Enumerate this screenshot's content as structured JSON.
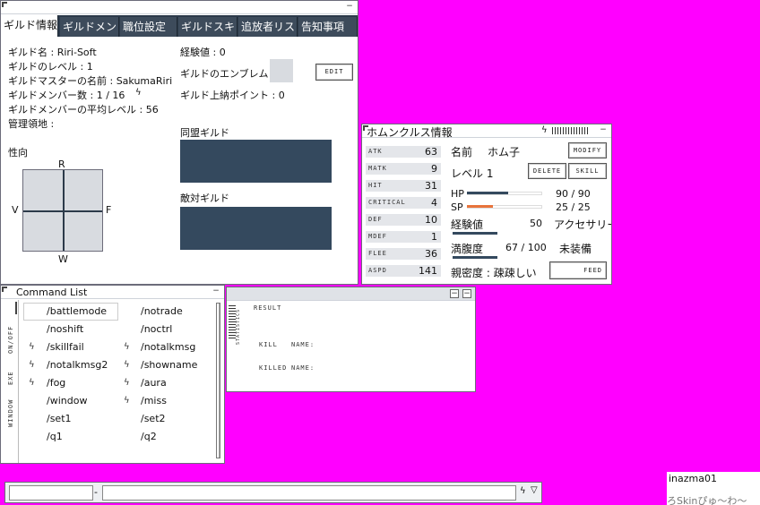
{
  "guild": {
    "tabs": [
      "ギルド情報",
      "ギルドメン・",
      "職位設定",
      "ギルドスキ・",
      "追放者リス・",
      "告知事項"
    ],
    "name_line": "ギルド名 : Riri-Soft",
    "level_line": "ギルドのレベル : 1",
    "master_line": "ギルドマスターの名前 : SakumaRiri",
    "members_line": "ギルドメンバー数 : 1 / 16",
    "avg_level_line": "ギルドメンバーの平均レベル : 56",
    "territory_line": "管理領地 :",
    "exp_line": "経験値 : 0",
    "emblem_label": "ギルドのエンブレム",
    "edit_button": "EDIT",
    "tax_points_line": "ギルド上納ポイント : 0",
    "alignment_label": "性向",
    "alignment_axes": {
      "top": "R",
      "left": "V",
      "right": "F",
      "bottom": "W"
    },
    "allied_label": "同盟ギルド",
    "hostile_label": "敵対ギルド"
  },
  "homunculus": {
    "title": "ホムンクルス情報",
    "stats": [
      {
        "label": "ATK",
        "value": "63"
      },
      {
        "label": "MATK",
        "value": "9"
      },
      {
        "label": "HIT",
        "value": "31"
      },
      {
        "label": "CRITICAL",
        "value": "4"
      },
      {
        "label": "DEF",
        "value": "10"
      },
      {
        "label": "MDEF",
        "value": "1"
      },
      {
        "label": "FLEE",
        "value": "36"
      },
      {
        "label": "ASPD",
        "value": "141"
      }
    ],
    "name_label": "名前",
    "name_value": "ホム子",
    "modify_button": "MODIFY",
    "level_line": "レベル 1",
    "delete_button": "DELETE",
    "skill_button": "SKILL",
    "hp_label": "HP",
    "hp_value": "90 / 90",
    "hp_fraction": 0.55,
    "sp_label": "SP",
    "sp_value": "25 / 25",
    "sp_fraction": 0.35,
    "exp_label": "経験値",
    "exp_value": "50",
    "accessory_label": "アクセサリー",
    "hunger_label": "満腹度",
    "hunger_value": "67 / 100",
    "unequipped": "未装備",
    "intimacy_line": "親密度 : 疎疎しい",
    "feed_button": "FEED"
  },
  "commands": {
    "title": "Command List",
    "side_tabs": [
      "ON/OFF",
      "EXE",
      "WINDOW"
    ],
    "items": [
      {
        "icon": false,
        "label": "/battlemode"
      },
      {
        "icon": false,
        "label": "/notrade"
      },
      {
        "icon": false,
        "label": "/noshift"
      },
      {
        "icon": false,
        "label": "/noctrl"
      },
      {
        "icon": true,
        "label": "/skillfail"
      },
      {
        "icon": true,
        "label": "/notalkmsg"
      },
      {
        "icon": true,
        "label": "/notalkmsg2"
      },
      {
        "icon": true,
        "label": "/showname"
      },
      {
        "icon": true,
        "label": "/fog"
      },
      {
        "icon": true,
        "label": "/aura"
      },
      {
        "icon": false,
        "label": "/window"
      },
      {
        "icon": true,
        "label": "/miss"
      },
      {
        "icon": false,
        "label": "/set1"
      },
      {
        "icon": false,
        "label": "/set2"
      },
      {
        "icon": false,
        "label": "/q1"
      },
      {
        "icon": false,
        "label": "/q2"
      }
    ]
  },
  "result": {
    "title": "RESULT",
    "side_label": "STATISTICS",
    "kill_label": "KILL",
    "kill_name_label": "NAME:",
    "killed_label": "KILLED",
    "killed_name_label": "NAME:"
  },
  "chatbar": {
    "separator": "-"
  },
  "nameplate": {
    "name": "inazma01",
    "skin": "ろSkinぴゅ〜わ〜"
  },
  "icons": {
    "lightning": "lightning-icon",
    "window_close": "minimize-icon"
  }
}
